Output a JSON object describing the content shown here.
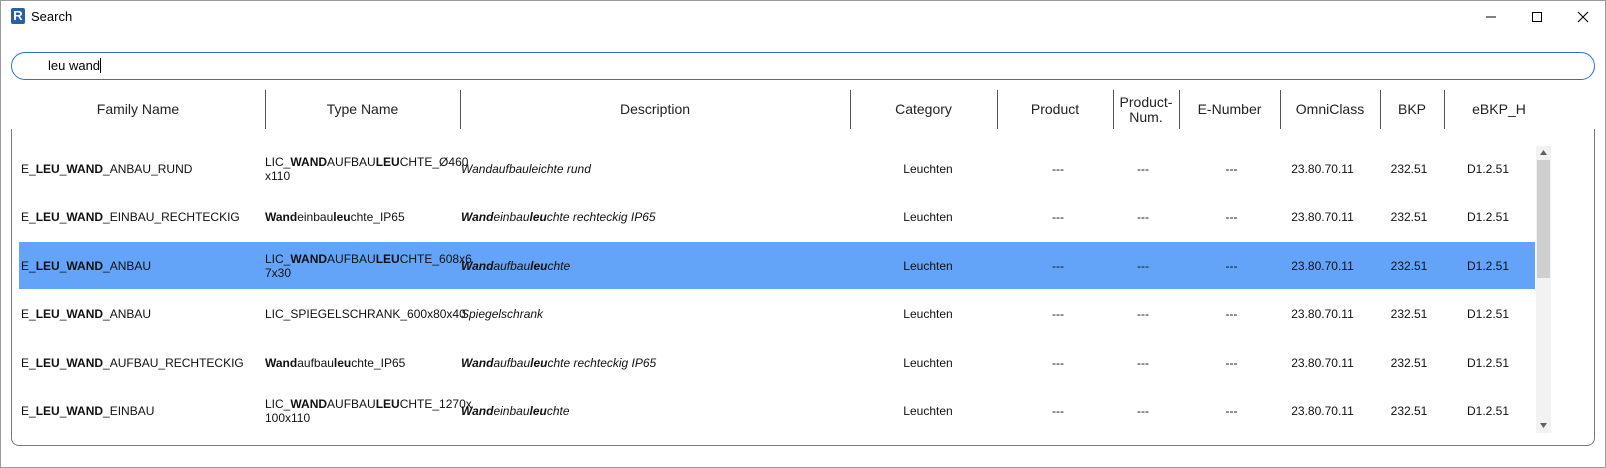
{
  "window": {
    "title": "Search",
    "app_icon_letter": "R",
    "controls": {
      "minimize": "minimize-icon",
      "maximize": "maximize-icon",
      "close": "close-icon"
    }
  },
  "search": {
    "value": "leu wand",
    "placeholder": ""
  },
  "columns": [
    "Family Name",
    "Type Name",
    "Description",
    "Category",
    "Product",
    "Product-Num.",
    "E-Number",
    "OmniClass",
    "BKP",
    "eBKP_H"
  ],
  "rows": [
    {
      "family": [
        {
          "t": "E_",
          "b": false
        },
        {
          "t": "LEU",
          "b": true
        },
        {
          "t": "_",
          "b": false
        },
        {
          "t": "WAND",
          "b": true
        },
        {
          "t": "_ANBAU_RUND",
          "b": false
        }
      ],
      "type": [
        {
          "t": "LIC_",
          "b": false
        },
        {
          "t": "WAND",
          "b": true
        },
        {
          "t": "AUFBAU",
          "b": false
        },
        {
          "t": "LEU",
          "b": true
        },
        {
          "t": "CHTE_Ø460",
          "b": false
        },
        {
          "t": "\nx110",
          "b": false
        }
      ],
      "description": [
        {
          "t": "Wandaufbauleichte rund",
          "b": false
        }
      ],
      "category": "Leuchten",
      "product": "---",
      "product_num": "---",
      "e_number": "---",
      "omniclass": "23.80.70.11",
      "bkp": "232.51",
      "ebkp_h": "D1.2.51",
      "selected": false
    },
    {
      "family": [
        {
          "t": "E_",
          "b": false
        },
        {
          "t": "LEU",
          "b": true
        },
        {
          "t": "_",
          "b": false
        },
        {
          "t": "WAND",
          "b": true
        },
        {
          "t": "_EINBAU_RECHTECKIG",
          "b": false
        }
      ],
      "type": [
        {
          "t": "Wand",
          "b": true
        },
        {
          "t": "einbau",
          "b": false
        },
        {
          "t": "leu",
          "b": true
        },
        {
          "t": "chte_IP65",
          "b": false
        }
      ],
      "description": [
        {
          "t": "Wand",
          "b": true
        },
        {
          "t": "einbau",
          "b": false
        },
        {
          "t": "leu",
          "b": true
        },
        {
          "t": "chte rechteckig IP65",
          "b": false
        }
      ],
      "category": "Leuchten",
      "product": "---",
      "product_num": "---",
      "e_number": "---",
      "omniclass": "23.80.70.11",
      "bkp": "232.51",
      "ebkp_h": "D1.2.51",
      "selected": false
    },
    {
      "family": [
        {
          "t": "E_",
          "b": false
        },
        {
          "t": "LEU",
          "b": true
        },
        {
          "t": "_",
          "b": false
        },
        {
          "t": "WAND",
          "b": true
        },
        {
          "t": "_ANBAU",
          "b": false
        }
      ],
      "type": [
        {
          "t": "LIC_",
          "b": false
        },
        {
          "t": "WAND",
          "b": true
        },
        {
          "t": "AUFBAU",
          "b": false
        },
        {
          "t": "LEU",
          "b": true
        },
        {
          "t": "CHTE_608x6",
          "b": false
        },
        {
          "t": "\n7x30",
          "b": false
        }
      ],
      "description": [
        {
          "t": "Wand",
          "b": true
        },
        {
          "t": "aufbau",
          "b": false
        },
        {
          "t": "leu",
          "b": true
        },
        {
          "t": "chte",
          "b": false
        }
      ],
      "category": "Leuchten",
      "product": "---",
      "product_num": "---",
      "e_number": "---",
      "omniclass": "23.80.70.11",
      "bkp": "232.51",
      "ebkp_h": "D1.2.51",
      "selected": true
    },
    {
      "family": [
        {
          "t": "E_",
          "b": false
        },
        {
          "t": "LEU",
          "b": true
        },
        {
          "t": "_",
          "b": false
        },
        {
          "t": "WAND",
          "b": true
        },
        {
          "t": "_ANBAU",
          "b": false
        }
      ],
      "type": [
        {
          "t": "LIC_SPIEGELSCHRANK_600x80x40",
          "b": false
        }
      ],
      "description": [
        {
          "t": "Spiegelschrank",
          "b": false
        }
      ],
      "category": "Leuchten",
      "product": "---",
      "product_num": "---",
      "e_number": "---",
      "omniclass": "23.80.70.11",
      "bkp": "232.51",
      "ebkp_h": "D1.2.51",
      "selected": false
    },
    {
      "family": [
        {
          "t": "E_",
          "b": false
        },
        {
          "t": "LEU",
          "b": true
        },
        {
          "t": "_",
          "b": false
        },
        {
          "t": "WAND",
          "b": true
        },
        {
          "t": "_AUFBAU_RECHTECKIG",
          "b": false
        }
      ],
      "type": [
        {
          "t": "Wand",
          "b": true
        },
        {
          "t": "aufbau",
          "b": false
        },
        {
          "t": "leu",
          "b": true
        },
        {
          "t": "chte_IP65",
          "b": false
        }
      ],
      "description": [
        {
          "t": "Wand",
          "b": true
        },
        {
          "t": "aufbau",
          "b": false
        },
        {
          "t": "leu",
          "b": true
        },
        {
          "t": "chte rechteckig IP65",
          "b": false
        }
      ],
      "category": "Leuchten",
      "product": "---",
      "product_num": "---",
      "e_number": "---",
      "omniclass": "23.80.70.11",
      "bkp": "232.51",
      "ebkp_h": "D1.2.51",
      "selected": false
    },
    {
      "family": [
        {
          "t": "E_",
          "b": false
        },
        {
          "t": "LEU",
          "b": true
        },
        {
          "t": "_",
          "b": false
        },
        {
          "t": "WAND",
          "b": true
        },
        {
          "t": "_EINBAU",
          "b": false
        }
      ],
      "type": [
        {
          "t": "LIC_",
          "b": false
        },
        {
          "t": "WAND",
          "b": true
        },
        {
          "t": "AUFBAU",
          "b": false
        },
        {
          "t": "LEU",
          "b": true
        },
        {
          "t": "CHTE_1270x",
          "b": false
        },
        {
          "t": "\n100x110",
          "b": false
        }
      ],
      "description": [
        {
          "t": "Wand",
          "b": true
        },
        {
          "t": "einbau",
          "b": false
        },
        {
          "t": "leu",
          "b": true
        },
        {
          "t": "chte",
          "b": false
        }
      ],
      "category": "Leuchten",
      "product": "---",
      "product_num": "---",
      "e_number": "---",
      "omniclass": "23.80.70.11",
      "bkp": "232.51",
      "ebkp_h": "D1.2.51",
      "selected": false
    }
  ],
  "colors": {
    "selection": "#64a4f8",
    "search_border": "#2f6fd6",
    "app_icon": "#2a5fa8"
  },
  "scrollbar": {
    "icons": [
      "scroll-up-icon",
      "scroll-down-icon"
    ]
  }
}
